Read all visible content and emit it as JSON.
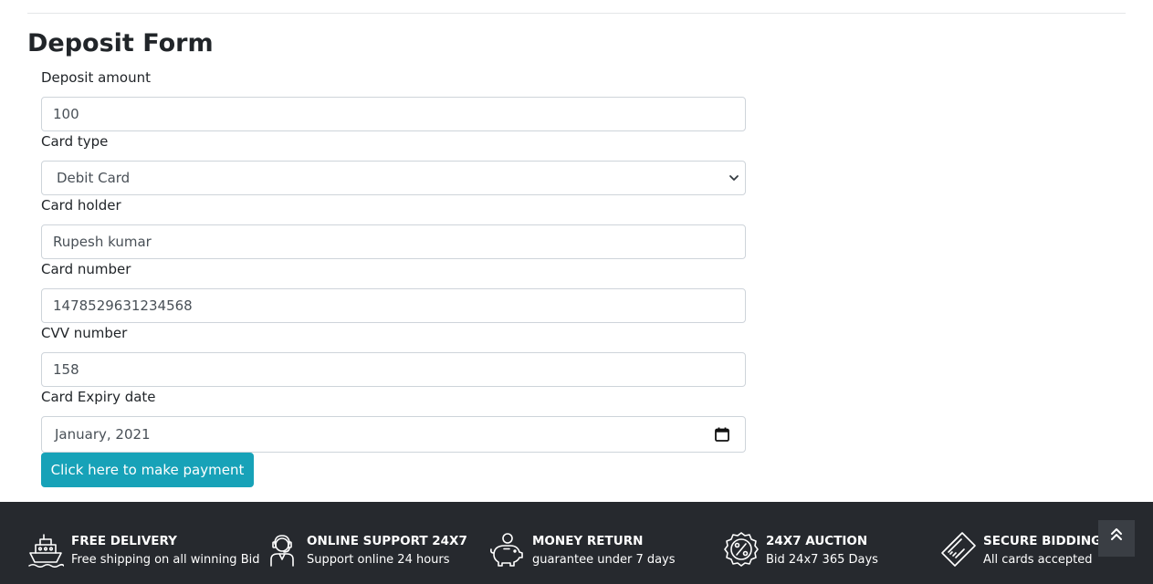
{
  "page": {
    "title": "Deposit Form"
  },
  "form": {
    "deposit_amount": {
      "label": "Deposit amount",
      "value": "100"
    },
    "card_type": {
      "label": "Card type",
      "value": "Debit Card"
    },
    "card_holder": {
      "label": "Card holder",
      "value": "Rupesh kumar"
    },
    "card_number": {
      "label": "Card number",
      "value": "1478529631234568"
    },
    "cvv": {
      "label": "CVV number",
      "value": "158"
    },
    "expiry": {
      "label": "Card Expiry date",
      "value": "January, 2021"
    },
    "submit_label": "Click here to make payment"
  },
  "footer": {
    "features": [
      {
        "icon": "ship-icon",
        "title": "FREE DELIVERY",
        "subtitle": "Free shipping on all winning Bid"
      },
      {
        "icon": "support-agent-icon",
        "title": "ONLINE SUPPORT 24X7",
        "subtitle": "Support online 24 hours"
      },
      {
        "icon": "piggy-bank-icon",
        "title": "MONEY RETURN",
        "subtitle": "guarantee under 7 days"
      },
      {
        "icon": "discount-badge-icon",
        "title": "24X7 AUCTION",
        "subtitle": "Bid 24x7 365 Days"
      },
      {
        "icon": "credit-card-icon",
        "title": "SECURE BIDDING",
        "subtitle": "All cards accepted"
      }
    ]
  },
  "colors": {
    "accent": "#17a2b8",
    "footer_bg": "#26292e",
    "text": "#212529"
  }
}
